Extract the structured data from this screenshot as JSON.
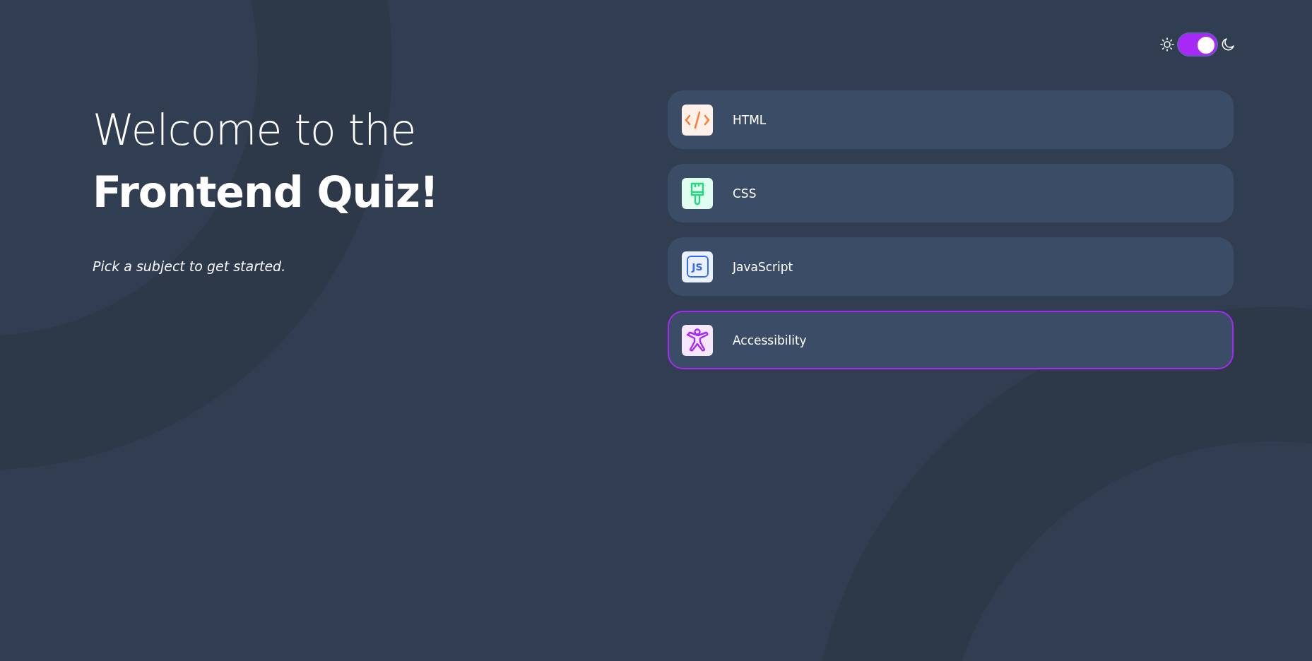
{
  "theme_toggle": {
    "on": true
  },
  "heading": {
    "line_1": "Welcome to the",
    "line_2": "Frontend Quiz!"
  },
  "subtitle": "Pick a subject to get started.",
  "subjects": [
    {
      "kind": "html",
      "label": "HTML",
      "selected": false
    },
    {
      "kind": "css",
      "label": "CSS",
      "selected": false
    },
    {
      "kind": "js",
      "label": "JavaScript",
      "icon_text": "JS",
      "selected": false
    },
    {
      "kind": "accessibility",
      "label": "Accessibility",
      "selected": true
    }
  ]
}
